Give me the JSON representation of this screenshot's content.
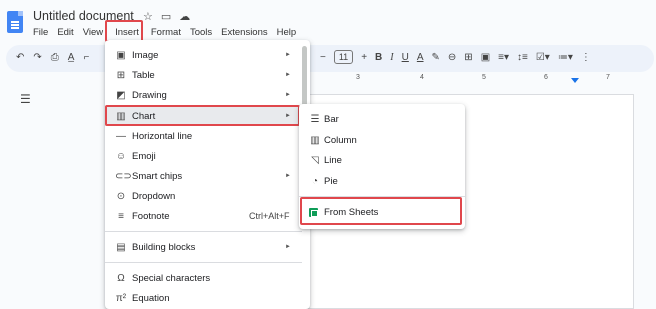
{
  "title": "Untitled document",
  "menubar": [
    "File",
    "Edit",
    "View",
    "Insert",
    "Format",
    "Tools",
    "Extensions",
    "Help"
  ],
  "toolbar": {
    "left_icons": [
      "undo-icon",
      "redo-icon",
      "print-icon",
      "spellcheck-icon",
      "paint-format-icon"
    ],
    "font_size": "11",
    "minus": "−",
    "plus": "+",
    "bold": "B",
    "italic": "I",
    "underline": "U",
    "text_color": "A"
  },
  "ruler": [
    "3",
    "4",
    "5",
    "6",
    "7"
  ],
  "insert_menu": {
    "items": [
      {
        "icon": "image-icon",
        "label": "Image",
        "submenu": true
      },
      {
        "icon": "table-icon",
        "label": "Table",
        "submenu": true
      },
      {
        "icon": "drawing-icon",
        "label": "Drawing",
        "submenu": true
      },
      {
        "icon": "chart-icon",
        "label": "Chart",
        "submenu": true
      },
      {
        "icon": "horizontal-line-icon",
        "label": "Horizontal line",
        "submenu": false
      },
      {
        "icon": "emoji-icon",
        "label": "Emoji",
        "submenu": false
      },
      {
        "icon": "smart-chips-icon",
        "label": "Smart chips",
        "submenu": true
      },
      {
        "icon": "dropdown-icon",
        "label": "Dropdown",
        "submenu": false
      },
      {
        "icon": "footnote-icon",
        "label": "Footnote",
        "shortcut": "Ctrl+Alt+F",
        "submenu": false
      },
      {
        "icon": "building-blocks-icon",
        "label": "Building blocks",
        "submenu": true
      },
      {
        "icon": "special-characters-icon",
        "label": "Special characters",
        "submenu": false
      },
      {
        "icon": "equation-icon",
        "label": "Equation",
        "submenu": false
      }
    ]
  },
  "chart_submenu": {
    "items": [
      {
        "icon": "bar-chart-icon",
        "label": "Bar"
      },
      {
        "icon": "column-chart-icon",
        "label": "Column"
      },
      {
        "icon": "line-chart-icon",
        "label": "Line"
      },
      {
        "icon": "pie-chart-icon",
        "label": "Pie"
      },
      {
        "icon": "sheets-icon",
        "label": "From Sheets"
      }
    ]
  },
  "colors": {
    "highlight_border": "#e0474c",
    "docs_blue": "#4285f4",
    "sheets_green": "#0f9d58",
    "toolbar_bg": "#edf2fa"
  }
}
